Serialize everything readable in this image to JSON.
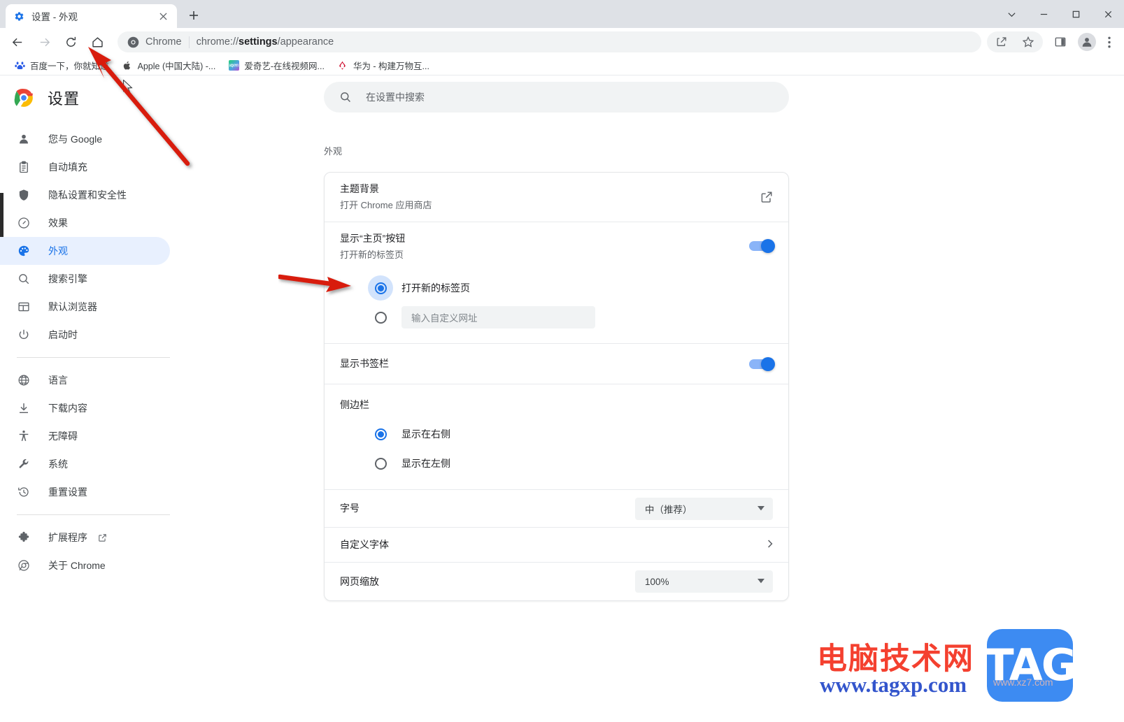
{
  "window": {
    "tab": {
      "title": "设置 - 外观",
      "favicon_icon": "gear-icon",
      "close_icon": "close-icon"
    },
    "new_tab_label": "+",
    "controls": {
      "tab_search_icon": "chevron-down-icon",
      "minimize_icon": "minimize-icon",
      "maximize_icon": "maximize-icon",
      "close_icon": "close-icon"
    }
  },
  "toolbar": {
    "back_icon": "arrow-back-icon",
    "forward_icon": "arrow-forward-icon",
    "reload_icon": "reload-icon",
    "home_icon": "home-icon",
    "omnibox": {
      "brand": "Chrome",
      "url_prefix": "chrome://",
      "url_bold": "settings",
      "url_suffix": "/appearance",
      "chrome_icon": "chrome-logo-icon"
    },
    "share_icon": "share-icon",
    "bookmark_icon": "star-icon",
    "side_panel_icon": "side-panel-icon",
    "profile_icon": "account-avatar-icon",
    "menu_icon": "three-dots-menu-icon"
  },
  "bookmarks": [
    {
      "label": "百度一下，你就知道",
      "icon": "baidu-icon"
    },
    {
      "label": "Apple (中国大陆) -...",
      "icon": "apple-icon"
    },
    {
      "label": "爱奇艺-在线视频网...",
      "icon": "iqiyi-icon"
    },
    {
      "label": "华为 - 构建万物互...",
      "icon": "huawei-icon"
    }
  ],
  "sidebar": {
    "brand": "设置",
    "brand_icon": "chrome-logo-icon",
    "groups": [
      {
        "items": [
          {
            "label": "您与 Google",
            "icon": "person-icon",
            "selected": false
          },
          {
            "label": "自动填充",
            "icon": "clipboard-icon",
            "selected": false
          },
          {
            "label": "隐私设置和安全性",
            "icon": "shield-icon",
            "selected": false
          },
          {
            "label": "效果",
            "icon": "speedometer-icon",
            "selected": false
          },
          {
            "label": "外观",
            "icon": "palette-icon",
            "selected": true
          },
          {
            "label": "搜索引擎",
            "icon": "search-icon",
            "selected": false
          },
          {
            "label": "默认浏览器",
            "icon": "browser-window-icon",
            "selected": false
          },
          {
            "label": "启动时",
            "icon": "power-icon",
            "selected": false
          }
        ]
      },
      {
        "items": [
          {
            "label": "语言",
            "icon": "globe-icon",
            "selected": false
          },
          {
            "label": "下载内容",
            "icon": "download-icon",
            "selected": false
          },
          {
            "label": "无障碍",
            "icon": "accessibility-icon",
            "selected": false
          },
          {
            "label": "系统",
            "icon": "wrench-icon",
            "selected": false
          },
          {
            "label": "重置设置",
            "icon": "history-restore-icon",
            "selected": false
          }
        ]
      },
      {
        "items": [
          {
            "label": "扩展程序",
            "icon": "puzzle-icon",
            "selected": false,
            "external": true
          },
          {
            "label": "关于 Chrome",
            "icon": "chrome-outline-icon",
            "selected": false
          }
        ]
      }
    ]
  },
  "search": {
    "placeholder": "在设置中搜索",
    "icon": "search-icon"
  },
  "main": {
    "section_title": "外观",
    "rows": {
      "theme": {
        "title": "主题背景",
        "subtitle": "打开 Chrome 应用商店",
        "end_icon": "external-link-icon"
      },
      "home_button": {
        "title": "显示“主页”按钮",
        "subtitle": "打开新的标签页",
        "toggle_on": true,
        "options": [
          {
            "label": "打开新的标签页",
            "selected": true,
            "type": "label"
          },
          {
            "label": "",
            "placeholder": "输入自定义网址",
            "selected": false,
            "type": "input"
          }
        ]
      },
      "bookmarks_bar": {
        "title": "显示书签栏",
        "toggle_on": true
      },
      "side_panel": {
        "title": "侧边栏",
        "options": [
          {
            "label": "显示在右侧",
            "selected": true
          },
          {
            "label": "显示在左侧",
            "selected": false
          }
        ]
      },
      "font_size": {
        "title": "字号",
        "value": "中（推荐）",
        "caret_icon": "caret-down-icon"
      },
      "customize_fonts": {
        "title": "自定义字体",
        "end_icon": "chevron-right-icon"
      },
      "page_zoom": {
        "title": "网页缩放",
        "value": "100%",
        "caret_icon": "caret-down-icon"
      }
    }
  },
  "watermark": {
    "title_cn": "电脑技术网",
    "url": "www.tagxp.com",
    "badge": "TAG",
    "sub_url": "www.xz7.com"
  },
  "colors": {
    "accent": "#1a73e8",
    "accent_light": "#8ab4f8",
    "selected_bg": "#e8f0fe",
    "annotation_red": "#d81f0f",
    "tabstrip_bg": "#dee1e6",
    "field_bg": "#f1f3f4"
  }
}
